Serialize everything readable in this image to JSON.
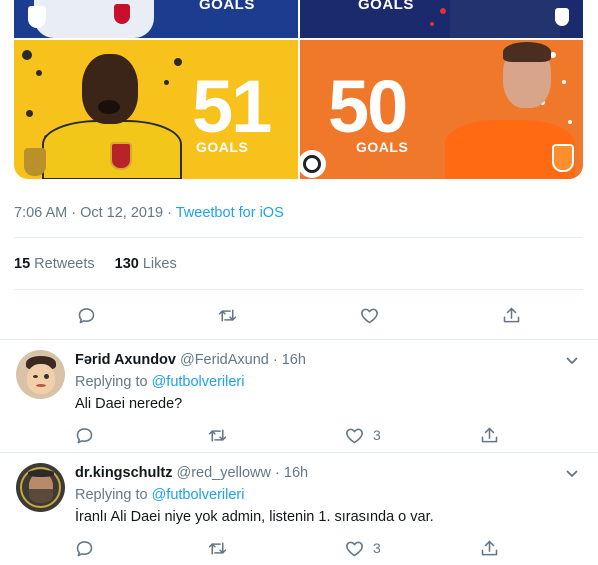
{
  "media": {
    "top_left": {
      "label": "GOALS"
    },
    "top_right": {
      "label": "GOALS"
    },
    "bottom_left": {
      "number": "51",
      "label": "GOALS",
      "color": "#f8c21c"
    },
    "bottom_right": {
      "number": "50",
      "label": "GOALS",
      "color": "#f0782a"
    }
  },
  "tweet": {
    "timestamp": "7:06 AM · Oct 12, 2019 · ",
    "source": "Tweetbot for iOS",
    "retweets_count": "15",
    "retweets_label": " Retweets",
    "likes_count": "130",
    "likes_label": " Likes",
    "icons": [
      "reply-icon",
      "retweet-icon",
      "like-icon",
      "share-icon"
    ]
  },
  "replies": [
    {
      "name": "Fərid Axundov",
      "handle": "@FeridAxund · 16h",
      "replying_prefix": "Replying to ",
      "replying_to": "@futbolverileri",
      "text": "Ali Daei nerede?",
      "likes": "3"
    },
    {
      "name": "dr.kingschultz",
      "handle": "@red_yelloww · 16h",
      "replying_prefix": "Replying to ",
      "replying_to": "@futbolverileri",
      "text": "İranlı Ali Daei niye yok admin, listenin 1. sırasında o var.",
      "likes": "3"
    }
  ],
  "colors": {
    "link": "#1da1f2",
    "muted": "#657786",
    "text": "#14171a",
    "border": "#e6ecf0"
  }
}
